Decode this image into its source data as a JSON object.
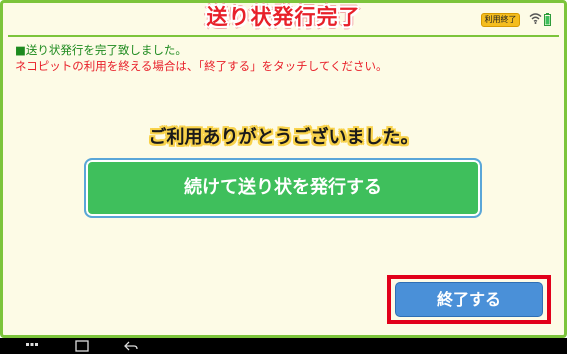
{
  "header": {
    "title": "送り状発行完了",
    "badge": "利用終了"
  },
  "messages": {
    "line1": "■送り状発行を完了致しました。",
    "line2": "ネコピットの利用を終える場合は、「終了する」をタッチしてください。"
  },
  "thanks": "ご利用ありがとうございました。",
  "buttons": {
    "continue": "続けて送り状を発行する",
    "finish": "終了する"
  },
  "colors": {
    "frame_border": "#7cc43b",
    "background": "#fdfbe6",
    "title": "#e8202a",
    "message_green": "#1d8a1e",
    "message_red": "#e8202a",
    "continue_button": "#3fbf5c",
    "finish_button": "#4a90d8",
    "highlight": "#e1001a",
    "badge": "#f4bd1f"
  },
  "icons": {
    "status": [
      "wifi-icon",
      "battery-icon"
    ],
    "navigation": [
      "menu-icon",
      "home-icon",
      "back-icon"
    ]
  }
}
